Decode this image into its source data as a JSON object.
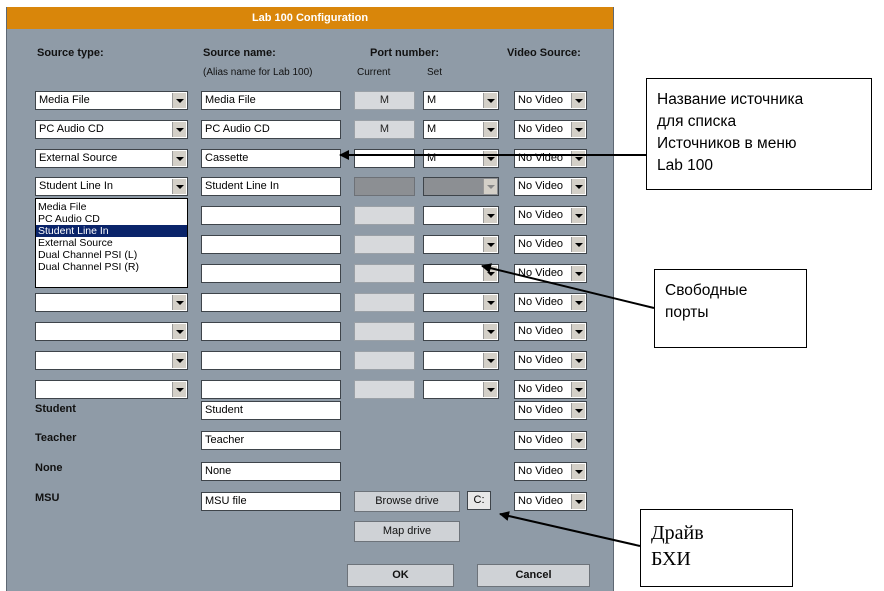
{
  "window": {
    "title": "Lab 100 Configuration"
  },
  "headers": {
    "source_type": "Source type:",
    "source_name": "Source name:",
    "alias_note": "(Alias name for Lab 100)",
    "port_number": "Port number:",
    "current": "Current",
    "set": "Set",
    "video_source": "Video Source:"
  },
  "rows": [
    {
      "type": "Media File",
      "name": "Media File",
      "current": "M",
      "set": "M",
      "video": "No Video"
    },
    {
      "type": "PC Audio CD",
      "name": "PC Audio CD",
      "current": "M",
      "set": "M",
      "video": "No Video"
    },
    {
      "type": "External Source",
      "name": "Cassette",
      "current": "",
      "set": "M",
      "video": "No Video"
    },
    {
      "type": "Student Line In",
      "name": "Student Line In",
      "current": "",
      "set": "",
      "video": "No Video"
    },
    {
      "type": "",
      "name": "",
      "current": "",
      "set": "",
      "video": "No Video"
    },
    {
      "type": "",
      "name": "",
      "current": "",
      "set": "",
      "video": "No Video"
    },
    {
      "type": "",
      "name": "",
      "current": "",
      "set": "",
      "video": "No Video"
    },
    {
      "type": "",
      "name": "",
      "current": "",
      "set": "",
      "video": "No Video"
    },
    {
      "type": "",
      "name": "",
      "current": "",
      "set": "",
      "video": "No Video"
    },
    {
      "type": "",
      "name": "",
      "current": "",
      "set": "",
      "video": "No Video"
    },
    {
      "type": "",
      "name": "",
      "current": "",
      "set": "",
      "video": "No Video"
    }
  ],
  "dropdown_options": [
    "Media File",
    "PC Audio CD",
    "Student Line In",
    "External Source",
    "Dual Channel PSI (L)",
    "Dual Channel PSI (R)"
  ],
  "dropdown_selected": "Student Line In",
  "fixed_rows": [
    {
      "label": "Student",
      "name": "Student",
      "video": "No Video"
    },
    {
      "label": "Teacher",
      "name": "Teacher",
      "video": "No Video"
    },
    {
      "label": "None",
      "name": "None",
      "video": "No Video"
    },
    {
      "label": "MSU",
      "name": "MSU file",
      "video": "No Video"
    }
  ],
  "buttons": {
    "browse_drive": "Browse drive",
    "drive_letter": "C:",
    "map_drive": "Map drive",
    "ok": "OK",
    "cancel": "Cancel"
  },
  "callouts": {
    "source_name_note": [
      "Название источника",
      "для списка",
      "Источников в меню",
      "Lab 100"
    ],
    "free_ports_note": [
      "Свободные",
      "порты"
    ],
    "drive_note": [
      "Драйв",
      "БХИ"
    ]
  },
  "colors": {
    "title_bar": "#d9860a",
    "window_bg": "#8f9ba7",
    "selection": "#0a246a"
  }
}
